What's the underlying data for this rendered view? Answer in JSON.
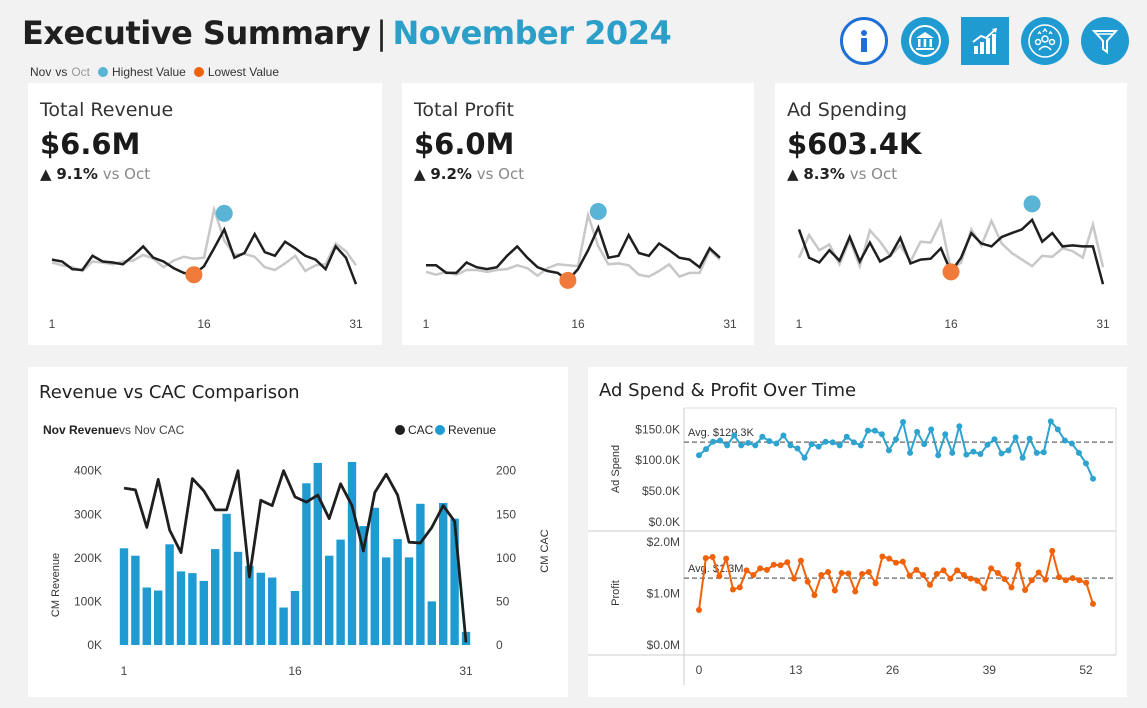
{
  "header": {
    "title": "Executive Summary",
    "separator": "|",
    "period": "November 2024",
    "legend": {
      "nov": "Nov",
      "vs": "vs",
      "oct": "Oct",
      "highest": "Highest Value",
      "lowest": "Lowest Value"
    },
    "icons": [
      "info-icon",
      "bank-icon",
      "growth-chart-icon",
      "team-icon",
      "filter-icon"
    ]
  },
  "colors": {
    "accent": "#2c9fc9",
    "highest": "#5ab4d6",
    "lowest": "#f07a3a",
    "bar": "#1f9bd1",
    "line": "#1f1f1f",
    "prior": "#c8c8c8",
    "adspend": "#2ea3d0",
    "profit": "#f0620a"
  },
  "kpis": [
    {
      "title": "Total Revenue",
      "value": "$6.6M",
      "arrow": "▲",
      "delta": "9.1%",
      "vs": "vs Oct",
      "axis": [
        "1",
        "16",
        "31"
      ],
      "nov": [
        48,
        46,
        38,
        37,
        52,
        46,
        45,
        43,
        52,
        62,
        50,
        46,
        39,
        34,
        32,
        41,
        60,
        80,
        50,
        55,
        75,
        56,
        52,
        67,
        60,
        52,
        48,
        38,
        62,
        50,
        22
      ],
      "oct": [
        45,
        42,
        40,
        36,
        46,
        45,
        43,
        46,
        47,
        53,
        49,
        40,
        47,
        51,
        49,
        50,
        101,
        68,
        53,
        54,
        51,
        40,
        37,
        44,
        52,
        36,
        42,
        43,
        65,
        57,
        42
      ],
      "max_day": 18,
      "min_day": 15
    },
    {
      "title": "Total Profit",
      "value": "$6.0M",
      "arrow": "▲",
      "delta": "9.2%",
      "vs": "vs Oct",
      "axis": [
        "1",
        "16",
        "31"
      ],
      "nov": [
        42,
        42,
        34,
        34,
        45,
        40,
        38,
        40,
        52,
        62,
        50,
        40,
        36,
        34,
        26,
        38,
        58,
        82,
        50,
        52,
        74,
        55,
        52,
        65,
        58,
        50,
        48,
        40,
        60,
        50
      ],
      "oct": [
        35,
        32,
        35,
        32,
        37,
        37,
        35,
        37,
        38,
        42,
        39,
        31,
        39,
        43,
        42,
        41,
        95,
        62,
        43,
        44,
        42,
        32,
        30,
        36,
        43,
        30,
        34,
        34,
        58,
        48
      ],
      "max_day": 18,
      "min_day": 15
    },
    {
      "title": "Ad Spending",
      "value": "$603.4K",
      "arrow": "▲",
      "delta": "8.3%",
      "vs": "vs Oct",
      "axis": [
        "1",
        "16",
        "31"
      ],
      "nov": [
        80,
        50,
        45,
        58,
        47,
        72,
        46,
        66,
        46,
        52,
        71,
        44,
        48,
        49,
        60,
        35,
        50,
        76,
        65,
        62,
        72,
        76,
        80,
        90,
        67,
        76,
        62,
        63,
        62,
        62,
        22
      ],
      "oct": [
        50,
        74,
        58,
        64,
        43,
        69,
        41,
        79,
        67,
        52,
        63,
        46,
        67,
        66,
        88,
        37,
        45,
        80,
        63,
        89,
        65,
        55,
        48,
        41,
        52,
        51,
        60,
        57,
        50,
        85,
        40
      ],
      "max_day": 24,
      "min_day": 16
    }
  ],
  "rev_cac": {
    "title": "Revenue vs CAC Comparison",
    "subtitle_bold": "Nov Revenue",
    "subtitle_rest": " vs Nov CAC",
    "legend_cac": "CAC",
    "legend_revenue": "Revenue",
    "ylabel_left": "CM Revenue",
    "ylabel_right": "CM CAC",
    "y_left_ticks": [
      "0K",
      "100K",
      "200K",
      "300K",
      "400K"
    ],
    "y_right_ticks": [
      "0",
      "50",
      "100",
      "150",
      "200"
    ],
    "x_ticks": [
      "1",
      "16",
      "31"
    ]
  },
  "chart_data": [
    {
      "type": "bar",
      "title": "Revenue vs CAC Comparison",
      "xlabel": "",
      "ylabel": "CM Revenue",
      "ylabel_right": "CM CAC",
      "x": [
        1,
        2,
        3,
        4,
        5,
        6,
        7,
        8,
        9,
        10,
        11,
        12,
        13,
        14,
        15,
        16,
        17,
        18,
        19,
        20,
        21,
        22,
        23,
        24,
        25,
        26,
        27,
        28,
        29,
        30,
        31
      ],
      "ylim": [
        0,
        420000
      ],
      "y2lim": [
        0,
        210000
      ],
      "series": [
        {
          "name": "Revenue",
          "axis": "left",
          "values": [
            222000,
            205000,
            132000,
            125000,
            231000,
            169000,
            165000,
            147000,
            220000,
            301000,
            214000,
            181000,
            166000,
            155000,
            86000,
            124000,
            371000,
            418000,
            205000,
            242000,
            420000,
            273000,
            315000,
            201000,
            243000,
            201000,
            324000,
            100000,
            326000,
            290000,
            30000
          ]
        },
        {
          "name": "CAC",
          "axis": "right",
          "values": [
            180,
            178,
            135,
            190,
            132,
            106,
            191,
            177,
            155,
            155,
            200,
            78,
            166,
            160,
            200,
            170,
            164,
            172,
            145,
            185,
            160,
            108,
            175,
            196,
            172,
            118,
            117,
            135,
            160,
            142,
            3
          ]
        }
      ]
    },
    {
      "type": "line",
      "title": "Ad Spend & Profit Over Time",
      "xlabel": "",
      "x_ticks": [
        "0",
        "13",
        "26",
        "39",
        "52"
      ],
      "series": [
        {
          "name": "Ad Spend",
          "average_label": "Avg. $129.3K",
          "average": 129300,
          "ylim": [
            0,
            170000
          ],
          "values": [
            108000,
            118000,
            130000,
            132000,
            124000,
            140000,
            124000,
            128000,
            124000,
            138000,
            131000,
            127000,
            140000,
            124000,
            119000,
            104000,
            126000,
            122000,
            130000,
            129000,
            124000,
            138000,
            129000,
            124000,
            148000,
            148000,
            142000,
            116000,
            134000,
            162000,
            112000,
            146000,
            126000,
            150000,
            108000,
            142000,
            112000,
            155000,
            109000,
            114000,
            110000,
            125000,
            134000,
            111000,
            116000,
            137000,
            104000,
            135000,
            112000,
            113000,
            163000,
            150000,
            132000,
            127000,
            112000,
            95000,
            70000
          ]
        },
        {
          "name": "Profit",
          "average_label": "Avg. $1.3M",
          "average": 1300000,
          "ylim": [
            0,
            2100000
          ],
          "values": [
            680000,
            1690000,
            1710000,
            1340000,
            1680000,
            1080000,
            1120000,
            1450000,
            1360000,
            1490000,
            1460000,
            1560000,
            1550000,
            1610000,
            1290000,
            1640000,
            1230000,
            970000,
            1360000,
            1420000,
            1060000,
            1400000,
            1390000,
            1040000,
            1380000,
            1420000,
            1200000,
            1720000,
            1680000,
            1600000,
            1620000,
            1350000,
            1460000,
            1360000,
            1170000,
            1380000,
            1450000,
            1290000,
            1450000,
            1360000,
            1290000,
            1250000,
            1100000,
            1490000,
            1400000,
            1280000,
            1120000,
            1560000,
            1070000,
            1260000,
            1410000,
            1270000,
            1830000,
            1320000,
            1260000,
            1300000,
            1260000,
            1210000,
            800000
          ]
        }
      ]
    }
  ],
  "adprofit": {
    "title": "Ad Spend & Profit Over Time",
    "ylabel_top": "Ad Spend",
    "ylabel_bottom": "Profit",
    "top_ticks": [
      "$0.0K",
      "$50.0K",
      "$100.0K",
      "$150.0K"
    ],
    "bottom_ticks": [
      "$0.0M",
      "$1.0M",
      "$2.0M"
    ],
    "avg_top": "Avg. $129.3K",
    "avg_bottom": "Avg. $1.3M",
    "x_ticks": [
      "0",
      "13",
      "26",
      "39",
      "52"
    ]
  }
}
